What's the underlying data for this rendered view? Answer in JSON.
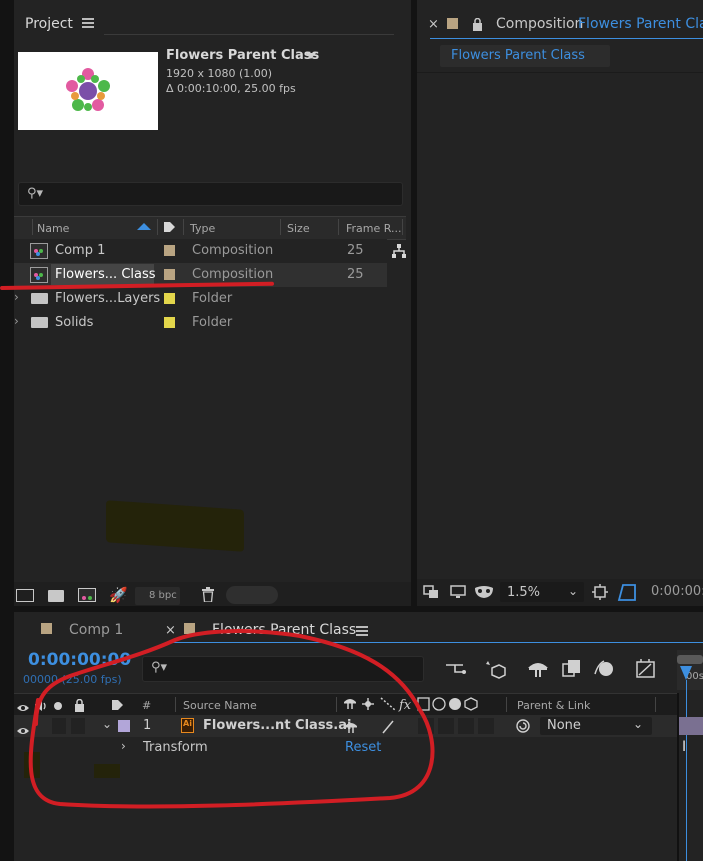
{
  "project": {
    "title": "Project",
    "comp_name": "Flowers Parent Class",
    "resolution": "1920 x 1080 (1.00)",
    "duration": "Δ 0:00:10:00, 25.00 fps",
    "search_placeholder": "",
    "columns": {
      "name": "Name",
      "type": "Type",
      "size": "Size",
      "frame_rate": "Frame R..."
    },
    "items": [
      {
        "name": "Comp 1",
        "type": "Composition",
        "frame_rate": "25",
        "label_color": "#b9a482",
        "kind": "comp"
      },
      {
        "name": "Flowers... Class",
        "type": "Composition",
        "frame_rate": "25",
        "label_color": "#b9a482",
        "kind": "comp"
      },
      {
        "name": "Flowers...Layers",
        "type": "Folder",
        "frame_rate": "",
        "label_color": "#e3d64b",
        "kind": "folder"
      },
      {
        "name": "Solids",
        "type": "Folder",
        "frame_rate": "",
        "label_color": "#e3d64b",
        "kind": "folder"
      }
    ],
    "bpc": "8 bpc"
  },
  "composition_viewer": {
    "panel_label": "Composition",
    "panel_comp": "Flowers Parent Class",
    "tab": "Flowers Parent Class",
    "zoom": "1.5%",
    "timecode": "0:00:00:"
  },
  "timeline": {
    "tabs": [
      "Comp 1",
      "Flowers Parent Class"
    ],
    "timecode": "0:00:00:00",
    "frames": "00000 (25.00 fps)",
    "search_placeholder": "",
    "columns": {
      "number": "#",
      "source_name": "Source Name",
      "parent_link": "Parent & Link"
    },
    "layer": {
      "number": "1",
      "name": "Flowers...nt Class.ai",
      "parent": "None"
    },
    "transform": {
      "label": "Transform",
      "reset": "Reset"
    },
    "ruler_label": "00s"
  },
  "colors": {
    "accent": "#3d8fe0",
    "annotation": "#d21e24",
    "comp_label": "#b9a482",
    "folder_label": "#e3d64b",
    "layer_label": "#b2a6d9"
  }
}
